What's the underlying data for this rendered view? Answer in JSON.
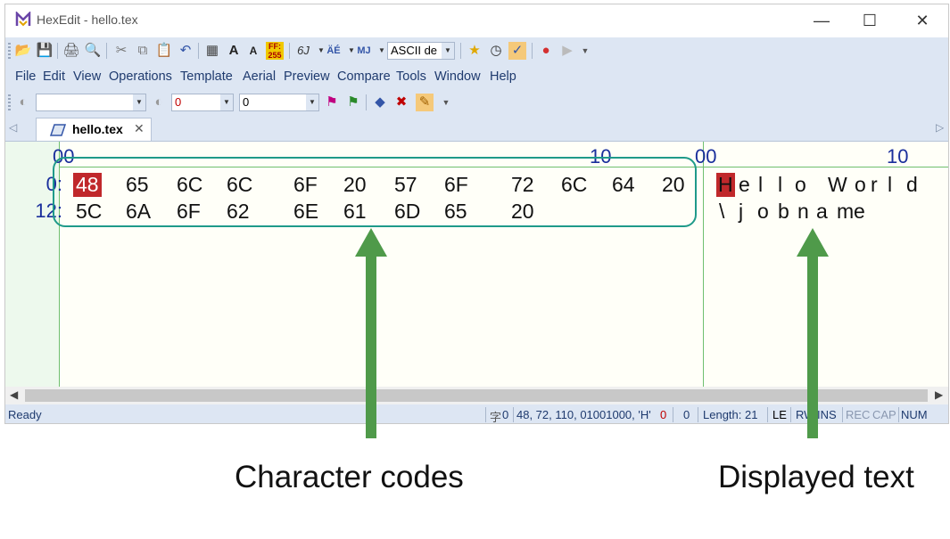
{
  "window": {
    "title": "HexEdit - hello.tex"
  },
  "toolbar": {
    "charset_combo": "ASCII de"
  },
  "menu": [
    "File",
    "Edit",
    "View",
    "Operations",
    "Template",
    "Aerial",
    "Preview",
    "Compare",
    "Tools",
    "Window",
    "Help"
  ],
  "find_bar": {
    "search_value": "",
    "hex_value": "0",
    "dec_value": "0"
  },
  "tab": {
    "label": "hello.tex"
  },
  "ruler": {
    "hex_start": "00",
    "hex_mid": "10",
    "char_start": "00",
    "char_mid": "10"
  },
  "rows": [
    {
      "address": "0:",
      "hex": [
        "48",
        "65",
        "6C",
        "6C",
        "6F",
        "20",
        "57",
        "6F",
        "72",
        "6C",
        "64",
        "20"
      ],
      "chars": [
        "H",
        "e",
        "l",
        "l",
        "o",
        " ",
        "W",
        "o",
        "r",
        "l",
        "d"
      ]
    },
    {
      "address": "12:",
      "hex": [
        "5C",
        "6A",
        "6F",
        "62",
        "6E",
        "61",
        "6D",
        "65",
        "20"
      ],
      "chars": [
        "\\",
        "j",
        "o",
        "b",
        "n",
        "a",
        "m",
        "e"
      ]
    }
  ],
  "status": {
    "ready": "Ready",
    "char_info_icon": "字",
    "char_count": "0",
    "value": "48, 72, 110, 01001000, 'H'",
    "sel_start": "0",
    "sel_len": "0",
    "length": "Length: 21",
    "endian": "LE",
    "rw": "RW",
    "ins": "INS",
    "rec": "REC",
    "cap": "CAP",
    "num": "NUM"
  },
  "annotations": {
    "left": "Character codes",
    "right": "Displayed text"
  },
  "colors": {
    "selection": "#c0282b",
    "hex_address": "#1a2f9c",
    "box": "#1f9a8a",
    "arrow": "#4f9a4a"
  }
}
